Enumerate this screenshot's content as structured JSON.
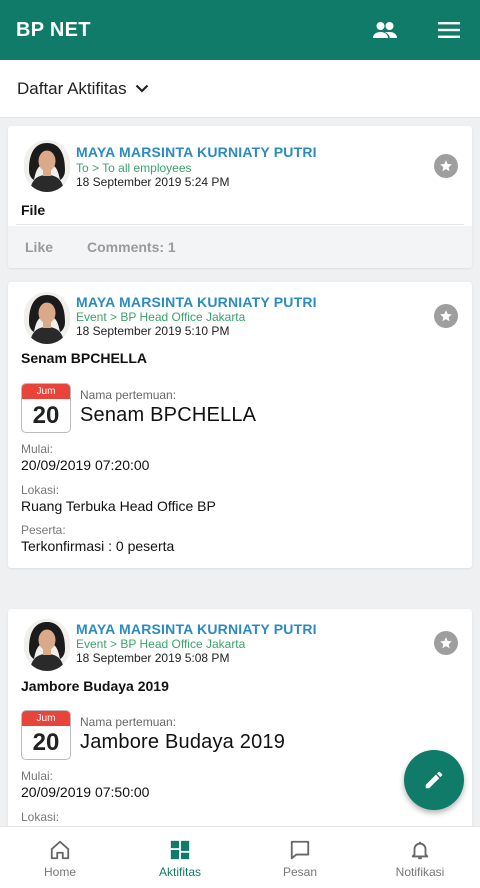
{
  "app": {
    "title": "BP NET"
  },
  "header": {
    "filter_label": "Daftar Aktifitas"
  },
  "posts": [
    {
      "author": "MAYA MARSINTA KURNIATY PUTRI",
      "target": "To > To all employees",
      "time": "18 September 2019 5:24 PM",
      "title": "File",
      "like_label": "Like",
      "comments_label": "Comments: 1"
    },
    {
      "author": "MAYA MARSINTA KURNIATY PUTRI",
      "target": "Event > BP Head Office Jakarta",
      "time": "18 September 2019 5:10 PM",
      "title": "Senam BPCHELLA",
      "event": {
        "month": "Jum",
        "day": "20",
        "name_label": "Nama pertemuan:",
        "name": "Senam BPCHELLA",
        "start_label": "Mulai:",
        "start": "20/09/2019 07:20:00",
        "location_label": "Lokasi:",
        "location": "Ruang Terbuka Head Office BP",
        "participants_label": "Peserta:",
        "participants": "Terkonfirmasi : 0 peserta"
      }
    },
    {
      "author": "MAYA MARSINTA KURNIATY PUTRI",
      "target": "Event > BP Head Office Jakarta",
      "time": "18 September 2019 5:08 PM",
      "title": "Jambore Budaya 2019",
      "event": {
        "month": "Jum",
        "day": "20",
        "name_label": "Nama pertemuan:",
        "name": "Jambore Budaya 2019",
        "start_label": "Mulai:",
        "start": "20/09/2019 07:50:00",
        "location_label": "Lokasi:"
      }
    }
  ],
  "nav": [
    {
      "label": "Home",
      "icon": "home-icon"
    },
    {
      "label": "Aktifitas",
      "icon": "activity-grid-icon"
    },
    {
      "label": "Pesan",
      "icon": "message-icon"
    },
    {
      "label": "Notifikasi",
      "icon": "bell-icon"
    }
  ],
  "active_nav": "Aktifitas",
  "colors": {
    "primary": "#0f7b68",
    "author": "#2b8bc0",
    "target": "#3aa36a",
    "calendar_red": "#e9443a"
  }
}
